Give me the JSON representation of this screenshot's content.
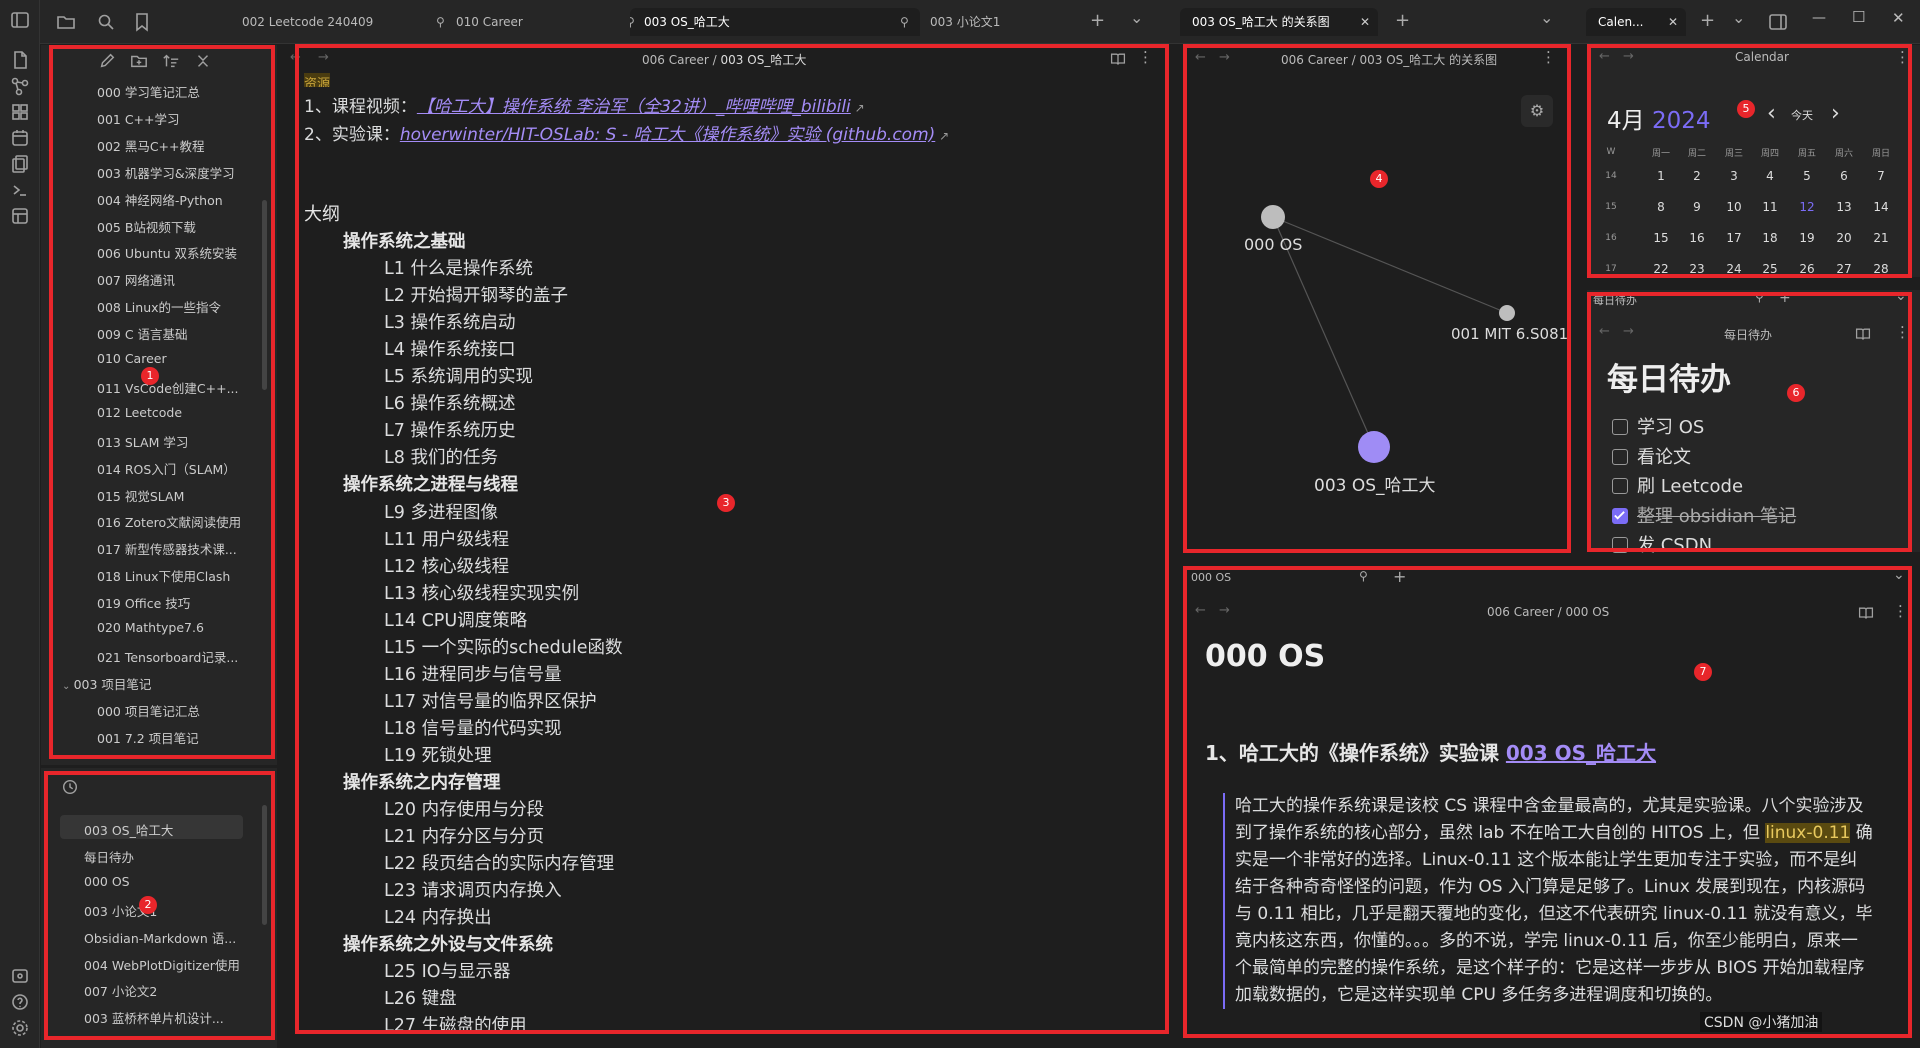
{
  "topbar": {
    "tabs": [
      "002 Leetcode 240409",
      "010 Career",
      "003 OS_哈工大",
      "003 小论文1"
    ],
    "graph_tab": "003 OS_哈工大 的关系图",
    "cal_tab": "Calen...",
    "plus": "+",
    "chev": "⌄"
  },
  "file_tree": {
    "items": [
      "000 学习笔记汇总",
      "001 C++学习",
      "002 黑马C++教程",
      "003 机器学习&深度学习",
      "004 神经网络-Python",
      "005 B站视频下载",
      "006 Ubuntu 双系统安装",
      "007 网络通讯",
      "008 Linux的一些指令",
      "009 C 语言基础",
      "010 Career",
      "011 VsCode创建C++...",
      "012 Leetcode",
      "013 SLAM 学习",
      "014 ROS入门（SLAM）",
      "015 视觉SLAM",
      "016 Zotero文献阅读使用",
      "017 新型传感器技术课...",
      "018 Linux下使用Clash",
      "019 Office 技巧",
      "020 Mathtype7.6",
      "021 Tensorboard记录..."
    ],
    "folder": "003 项目笔记",
    "sub_items": [
      "000 项目笔记汇总",
      "001 7.2 项目笔记"
    ]
  },
  "recent": {
    "items": [
      "003 OS_哈工大",
      "每日待办",
      "000 OS",
      "003 小论文1",
      "Obsidian-Markdown 语...",
      "004 WebPlotDigitizer使用",
      "007 小论文2",
      "003 蓝桥杯单片机设计..."
    ]
  },
  "editor": {
    "crumb_parent": "006 Career",
    "crumb_sep": "/",
    "crumb_file": "003 OS_哈工大",
    "top_tag": "资源",
    "line1_prefix": "1、课程视频：",
    "line1_link": "【哈工大】操作系统 李治军（全32讲）_哔哩哔哩_bilibili",
    "line2_prefix": "2、实验课：",
    "line2_link": "hoverwinter/HIT-OSLab: S - 哈工大《操作系统》实验 (github.com)",
    "outline_title": "大纲",
    "outline": [
      {
        "t": "操作系统之基础",
        "h": true
      },
      {
        "t": "L1 什么是操作系统"
      },
      {
        "t": "L2 开始揭开钢琴的盖子"
      },
      {
        "t": "L3 操作系统启动"
      },
      {
        "t": "L4 操作系统接口"
      },
      {
        "t": "L5 系统调用的实现"
      },
      {
        "t": "L6 操作系统概述"
      },
      {
        "t": "L7 操作系统历史"
      },
      {
        "t": "L8 我们的任务"
      },
      {
        "t": "操作系统之进程与线程",
        "h": true
      },
      {
        "t": "L9 多进程图像"
      },
      {
        "t": "L11 用户级线程"
      },
      {
        "t": "L12 核心级线程"
      },
      {
        "t": "L13 核心级线程实现实例"
      },
      {
        "t": "L14 CPU调度策略"
      },
      {
        "t": "L15 一个实际的schedule函数"
      },
      {
        "t": "L16 进程同步与信号量"
      },
      {
        "t": "L17 对信号量的临界区保护"
      },
      {
        "t": "L18 信号量的代码实现"
      },
      {
        "t": "L19 死锁处理"
      },
      {
        "t": "操作系统之内存管理",
        "h": true
      },
      {
        "t": "L20 内存使用与分段"
      },
      {
        "t": "L21 内存分区与分页"
      },
      {
        "t": "L22 段页结合的实际内存管理"
      },
      {
        "t": "L23 请求调页内存换入"
      },
      {
        "t": "L24 内存换出"
      },
      {
        "t": "操作系统之外设与文件系统",
        "h": true
      },
      {
        "t": "L25 IO与显示器"
      },
      {
        "t": "L26 键盘"
      },
      {
        "t": "L27 生磁盘的使用"
      }
    ]
  },
  "graph": {
    "crumb_parent": "006 Career",
    "crumb_file": "003 OS_哈工大 的关系图",
    "nodes": [
      "000 OS",
      "001 MIT 6.S081",
      "003 OS_哈工大"
    ]
  },
  "calendar": {
    "header": "Calendar",
    "month": "4月",
    "year": "2024",
    "today": "今天",
    "weekday_label": "W",
    "weekdays": [
      "周一",
      "周二",
      "周三",
      "周四",
      "周五",
      "周六",
      "周日"
    ],
    "weeks": [
      {
        "w": "14",
        "d": [
          "1",
          "2",
          "3",
          "4",
          "5",
          "6",
          "7"
        ]
      },
      {
        "w": "15",
        "d": [
          "8",
          "9",
          "10",
          "11",
          "12",
          "13",
          "14"
        ]
      },
      {
        "w": "16",
        "d": [
          "15",
          "16",
          "17",
          "18",
          "19",
          "20",
          "21"
        ]
      },
      {
        "w": "17",
        "d": [
          "22",
          "23",
          "24",
          "25",
          "26",
          "27",
          "28"
        ]
      }
    ],
    "accent": "#7b6cf6"
  },
  "daily": {
    "tab": "每日待办",
    "crumb": "每日待办",
    "title": "每日待办",
    "todos": [
      {
        "t": "学习 OS",
        "done": false
      },
      {
        "t": "看论文",
        "done": false
      },
      {
        "t": "刷 Leetcode",
        "done": false
      },
      {
        "t": "整理 obsidian 笔记",
        "done": true
      },
      {
        "t": "发 CSDN",
        "done": false
      }
    ]
  },
  "note": {
    "tab": "000 OS",
    "crumb_parent": "006 Career",
    "crumb_file": "000 OS",
    "title": "000 OS",
    "h2_prefix": "1、哈工大的《操作系统》实验课 ",
    "h2_link": "003 OS_哈工大",
    "para_a": "哈工大的操作系统课是该校 CS 课程中含金量最高的，尤其是实验课。八个实验涉及到了操作系统的核心部分，虽然 lab 不在哈工大自创的 HITOS 上，但 ",
    "para_hl": "linux-0.11",
    "para_b": " 确实是一个非常好的选择。Linux-0.11 这个版本能让学生更加专注于实验，而不是纠结于各种奇奇怪怪的问题，作为 OS 入门算是足够了。Linux 发展到现在，内核源码与 0.11 相比，几乎是翻天覆地的变化，但这不代表研究 linux-0.11 就没有意义，毕竟内核这东西，你懂的。。。多的不说，学完 linux-0.11 后，你至少能明白，原来一个最简单的完整的操作系统，是这个样子的：它是这样一步步从 BIOS 开始加载程序加载数据的，它是这样实现单 CPU 多任务多进程调度和切换的。"
  },
  "watermark": "CSDN @小猪加油",
  "badges": [
    "1",
    "2",
    "3",
    "4",
    "5",
    "6",
    "7"
  ]
}
